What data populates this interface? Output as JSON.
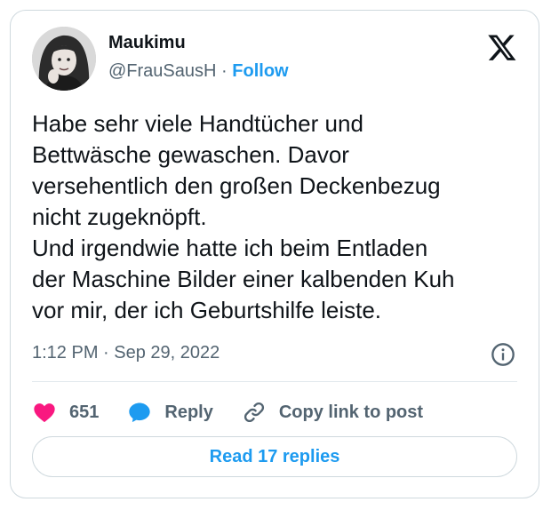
{
  "author": {
    "name": "Maukimu",
    "handle": "@FrauSausH",
    "separator": "·",
    "follow_label": "Follow"
  },
  "tweet": {
    "text": "Habe sehr viele Handtücher und\nBettwäsche gewaschen. Davor\nversehentlich den großen Deckenbezug\nnicht zugeknöpft.\nUnd irgendwie hatte ich beim Entladen\nder Maschine Bilder einer kalbenden Kuh\nvor mir, der ich Geburtshilfe leiste.",
    "time": "1:12 PM",
    "date_separator": "·",
    "date": "Sep 29, 2022"
  },
  "actions": {
    "like_count": "651",
    "reply_label": "Reply",
    "copy_link_label": "Copy link to post"
  },
  "footer": {
    "read_replies_label": "Read 17 replies"
  },
  "icons": {
    "logo": "x-logo-icon",
    "info": "info-icon",
    "like": "heart-icon",
    "reply": "speech-bubble-icon",
    "copy_link": "link-icon"
  },
  "colors": {
    "accent": "#1d9bf0",
    "like": "#f91880",
    "secondary_text": "#536471",
    "border": "#cfd9de"
  }
}
